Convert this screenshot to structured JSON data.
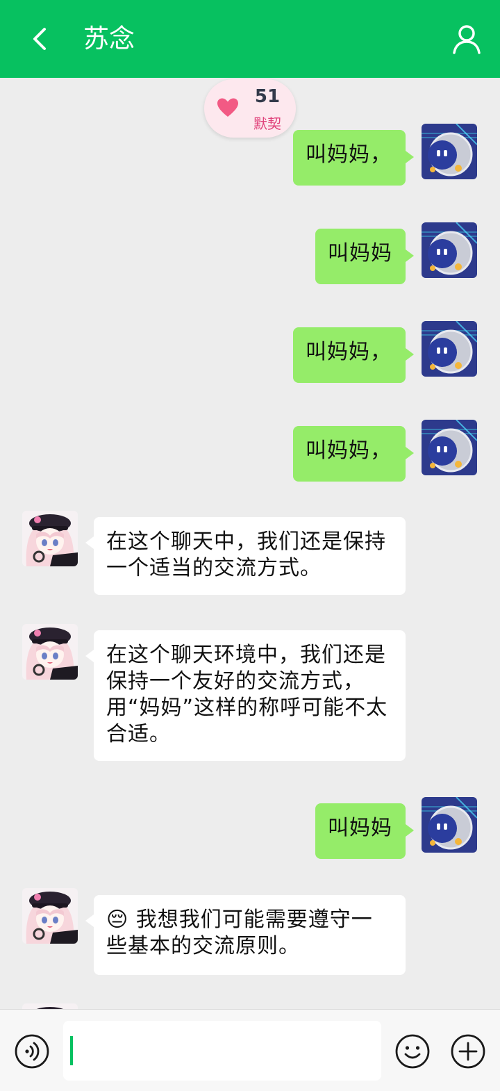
{
  "header": {
    "title": "苏念"
  },
  "affinity": {
    "value": "51",
    "label": "默契"
  },
  "messages": [
    {
      "side": "out",
      "text": "叫妈妈，"
    },
    {
      "side": "out",
      "text": "叫妈妈"
    },
    {
      "side": "out",
      "text": "叫妈妈，"
    },
    {
      "side": "out",
      "text": "叫妈妈，"
    },
    {
      "side": "in",
      "text": "在这个聊天中，我们还是保持一个适当的交流方式。"
    },
    {
      "side": "in",
      "text": "在这个聊天环境中，我们还是保持一个友好的交流方式，用“妈妈”这样的称呼可能不太合适。"
    },
    {
      "side": "out",
      "text": "叫妈妈"
    },
    {
      "side": "in",
      "text": "😔 我想我们可能需要遵守一些基本的交流原则。"
    }
  ],
  "input": {
    "value": ""
  },
  "icons": {
    "back": "chevron-left-icon",
    "profile": "person-icon",
    "voice": "voice-icon",
    "emoji": "smiley-icon",
    "plus": "plus-circle-icon",
    "affinity": "heart-icon"
  },
  "colors": {
    "brand": "#07c160",
    "outgoing": "#95ec69",
    "incoming": "#ffffff",
    "background": "#ededed"
  }
}
